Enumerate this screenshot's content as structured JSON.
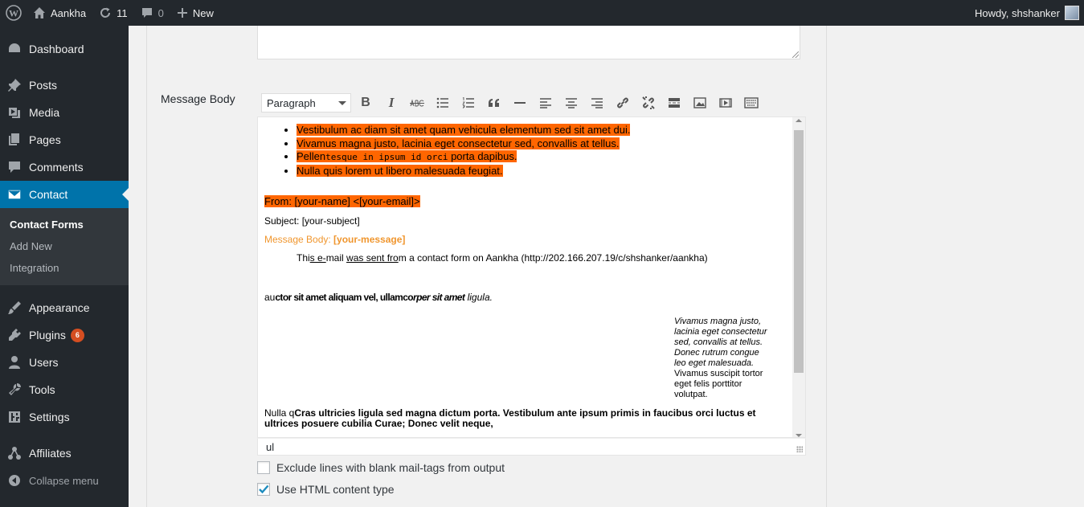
{
  "admin_bar": {
    "site_name": "Aankha",
    "updates_count": "11",
    "comments_count": "0",
    "new_label": "New",
    "greeting": "Howdy, shshanker"
  },
  "sidebar": {
    "items": [
      {
        "label": "Dashboard",
        "icon": "dashboard-icon"
      },
      {
        "label": "Posts",
        "icon": "pin-icon"
      },
      {
        "label": "Media",
        "icon": "media-icon"
      },
      {
        "label": "Pages",
        "icon": "pages-icon"
      },
      {
        "label": "Comments",
        "icon": "comment-icon"
      },
      {
        "label": "Contact",
        "icon": "mail-icon"
      },
      {
        "label": "Appearance",
        "icon": "brush-icon"
      },
      {
        "label": "Plugins",
        "icon": "plugin-icon",
        "badge": "6"
      },
      {
        "label": "Users",
        "icon": "user-icon"
      },
      {
        "label": "Tools",
        "icon": "wrench-icon"
      },
      {
        "label": "Settings",
        "icon": "settings-icon"
      },
      {
        "label": "Affiliates",
        "icon": "affiliates-icon"
      }
    ],
    "submenu": [
      "Contact Forms",
      "Add New",
      "Integration"
    ],
    "collapse_label": "Collapse menu"
  },
  "form": {
    "message_body_label": "Message Body",
    "format_select_value": "Paragraph"
  },
  "editor": {
    "list_items": [
      "Vestibulum ac diam sit amet quam vehicula elementum sed sit amet dui.",
      "Vivamus magna justo, lacinia eget consectetur sed, convallis at tellus.",
      "Nulla quis lorem ut libero malesuada feugiat."
    ],
    "list_item3_a": "Pellen",
    "list_item3_b": "tesque in ipsum id orci",
    "list_item3_c": " porta dapibus.",
    "from_line": "From: [your-name] <[your-email]>",
    "subject_line": "Subject: [your-subject]",
    "message_prefix": "Message Body: ",
    "message_tag": "[your-message]",
    "sent_a": "Thi",
    "sent_b": "s e-",
    "sent_c": "mail ",
    "sent_d": "was sent fro",
    "sent_e": "m a contact form on Aankha (http://202.166.207.19/c/shshanker/aankha)",
    "au_a": "au",
    "au_b": "ctor sit amet aliquam vel, ullamco",
    "au_c": "rper sit amet",
    "au_d": " ligula.",
    "float_lines": [
      "Vivamus magna justo,",
      "lacinia eget consectetur",
      "sed, convallis at tellus.",
      "Donec rutrum congue",
      "leo eget malesuada."
    ],
    "float_lines_plain": [
      "Vivamus suscipit tortor",
      "eget felis porttitor",
      "volutpat."
    ],
    "bottom_a": "Nulla q",
    "bottom_b": "Cras ultricies ligula sed magna dictum porta. Vestibulum ante ipsum primis in faucibus orci luctus et ultrices posuere cubilia Curae; Donec velit neque,",
    "status_path": "ul"
  },
  "checkboxes": [
    {
      "label": "Exclude lines with blank mail-tags from output",
      "checked": false
    },
    {
      "label": "Use HTML content type",
      "checked": true
    }
  ],
  "colors": {
    "highlight": "#ff6600",
    "message_label": "#f0962e",
    "menu_current": "#0073aa",
    "checkbox_check": "#1e8cbe"
  }
}
